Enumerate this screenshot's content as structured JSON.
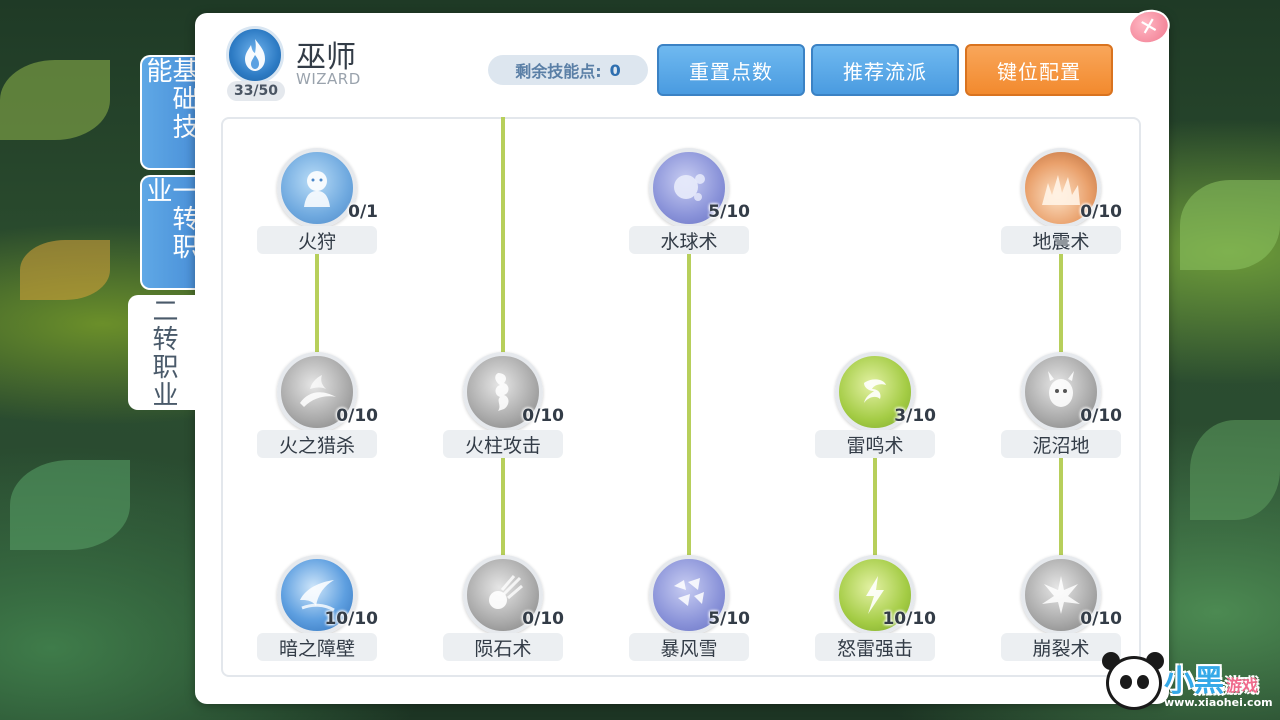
{
  "side_tabs": [
    {
      "label": "基础技能",
      "active": false
    },
    {
      "label": "一转职业",
      "active": false
    },
    {
      "label": "二转职业",
      "active": true
    }
  ],
  "class_info": {
    "name": "巫师",
    "english": "WIZARD",
    "level": "33/50",
    "emblem_icon": "flame-emblem-icon"
  },
  "skill_points": {
    "label": "剩余技能点:",
    "value": "0"
  },
  "buttons": {
    "reset": "重置点数",
    "recommend": "推荐流派",
    "keybind": "键位配置"
  },
  "close_icon": "close-icon",
  "skills": [
    {
      "name": "火狩",
      "level": "0/1",
      "icon": "spirit-icon",
      "color": "blue"
    },
    {
      "name": "水球术",
      "level": "5/10",
      "icon": "water-ball-icon",
      "color": "purple"
    },
    {
      "name": "地震术",
      "level": "0/10",
      "icon": "earthquake-icon",
      "color": "orange"
    },
    {
      "name": "火之猎杀",
      "level": "0/10",
      "icon": "fire-hunt-icon",
      "color": "gray"
    },
    {
      "name": "火柱攻击",
      "level": "0/10",
      "icon": "fire-pillar-icon",
      "color": "gray"
    },
    {
      "name": "雷鸣术",
      "level": "3/10",
      "icon": "thunder-icon",
      "color": "green"
    },
    {
      "name": "泥沼地",
      "level": "0/10",
      "icon": "swamp-icon",
      "color": "gray"
    },
    {
      "name": "暗之障壁",
      "level": "10/10",
      "icon": "dark-barrier-icon",
      "color": "deepblue"
    },
    {
      "name": "陨石术",
      "level": "0/10",
      "icon": "meteor-icon",
      "color": "gray"
    },
    {
      "name": "暴风雪",
      "level": "5/10",
      "icon": "blizzard-icon",
      "color": "purple"
    },
    {
      "name": "怒雷强击",
      "level": "10/10",
      "icon": "thunder-strike-icon",
      "color": "green"
    },
    {
      "name": "崩裂术",
      "level": "0/10",
      "icon": "shatter-icon",
      "color": "gray"
    }
  ],
  "watermark": {
    "text": "小黑",
    "subtext": "游戏",
    "url": "www.xiaohei.com"
  }
}
